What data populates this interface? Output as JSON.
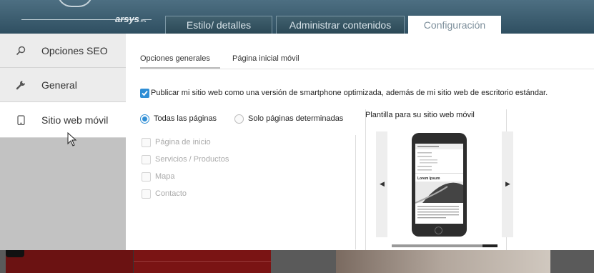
{
  "brand": {
    "logo_text": "arsys",
    "logo_sup": ".es"
  },
  "top_tabs": [
    {
      "label": "Estilo/ detalles"
    },
    {
      "label": "Administrar contenidos"
    },
    {
      "label": "Configuración",
      "active": true
    }
  ],
  "sidebar": {
    "items": [
      {
        "label": "Opciones SEO",
        "icon": "search-icon"
      },
      {
        "label": "General",
        "icon": "wrench-icon"
      },
      {
        "label": "Sitio web móvil",
        "icon": "mobile-icon",
        "active": true
      }
    ]
  },
  "main": {
    "subtabs": [
      {
        "label": "Opciones generales",
        "active": true
      },
      {
        "label": "Página inicial móvil"
      }
    ],
    "publish_checkbox": {
      "checked": true,
      "label": "Publicar mi sitio web como una versión de smartphone optimizada, además de mi sitio web de escritorio estándar."
    },
    "radios": [
      {
        "label": "Todas las páginas",
        "selected": true
      },
      {
        "label": "Solo páginas determinadas",
        "selected": false
      }
    ],
    "pages": [
      {
        "label": "Página de inicio",
        "checked": false
      },
      {
        "label": "Servicios / Productos",
        "checked": false
      },
      {
        "label": "Mapa",
        "checked": false
      },
      {
        "label": "Contacto",
        "checked": false
      }
    ],
    "template": {
      "title": "Plantilla para su sitio web móvil",
      "preview_heading": "Lorem Ipsum"
    }
  },
  "colors": {
    "accent": "#2f8ed5",
    "topbar": "#3f6072"
  }
}
